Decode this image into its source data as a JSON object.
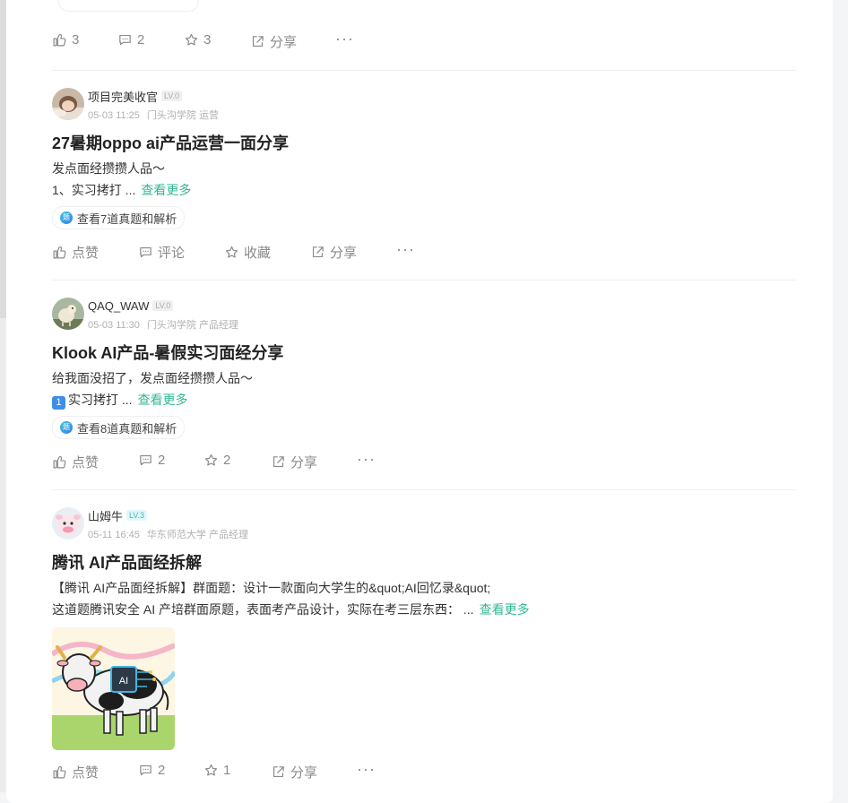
{
  "top_actions": {
    "like": "3",
    "comment": "2",
    "favorite": "3",
    "share": "分享"
  },
  "posts": [
    {
      "username": "项目完美收官",
      "level": "LV.0",
      "date": "05-03 11:25",
      "affiliation": "门头沟学院 运营",
      "title": "27暑期oppo ai产品运营一面分享",
      "line1": "发点面经攒攒人品～",
      "line2": "1、实习拷打 ...",
      "more": "查看更多",
      "tag": "查看7道真题和解析",
      "actions": {
        "like": "点赞",
        "comment": "评论",
        "favorite": "收藏",
        "share": "分享"
      }
    },
    {
      "username": "QAQ_WAW",
      "level": "LV.0",
      "date": "05-03 11:30",
      "affiliation": "门头沟学院 产品经理",
      "title": "Klook AI产品-暑假实习面经分享",
      "line1": "给我面没招了，发点面经攒攒人品～",
      "line2_emoji": "1",
      "line2": "实习拷打 ...",
      "more": "查看更多",
      "tag": "查看8道真题和解析",
      "actions": {
        "like": "点赞",
        "comment": "2",
        "favorite": "2",
        "share": "分享"
      }
    },
    {
      "username": "山姆牛",
      "level": "LV.3",
      "date": "05-11 16:45",
      "affiliation": "华东师范大学 产品经理",
      "title": "腾讯 AI产品面经拆解",
      "line1": "【腾讯 AI产品面经拆解】群面题：设计一款面向大学生的&quot;AI回忆录&quot;",
      "line2": "这道题腾讯安全 AI 产培群面原题，表面考产品设计，实际在考三层东西：  ...",
      "more": "查看更多",
      "image_text": "AI",
      "actions": {
        "like": "点赞",
        "comment": "2",
        "favorite": "1",
        "share": "分享"
      }
    }
  ],
  "more_icon": "ellipsis-icon",
  "accent_color": "#32b894"
}
